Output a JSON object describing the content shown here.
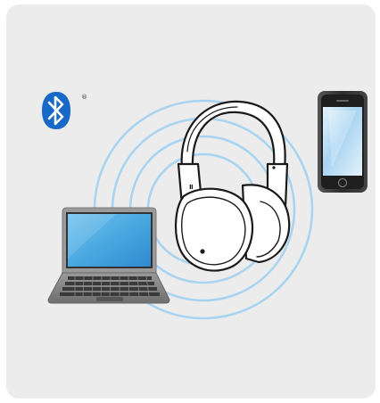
{
  "diagram": {
    "bluetooth_mark": "®",
    "colors": {
      "card_background": "#ececec",
      "bluetooth_blue": "#1769c7",
      "wave_blue": "#a9d4f1",
      "screen_blue": "#4aa8e0",
      "laptop_gray": "#8b8b8b"
    },
    "icons": [
      "bluetooth-icon",
      "smartphone-icon",
      "laptop-icon",
      "headphones-icon"
    ]
  }
}
